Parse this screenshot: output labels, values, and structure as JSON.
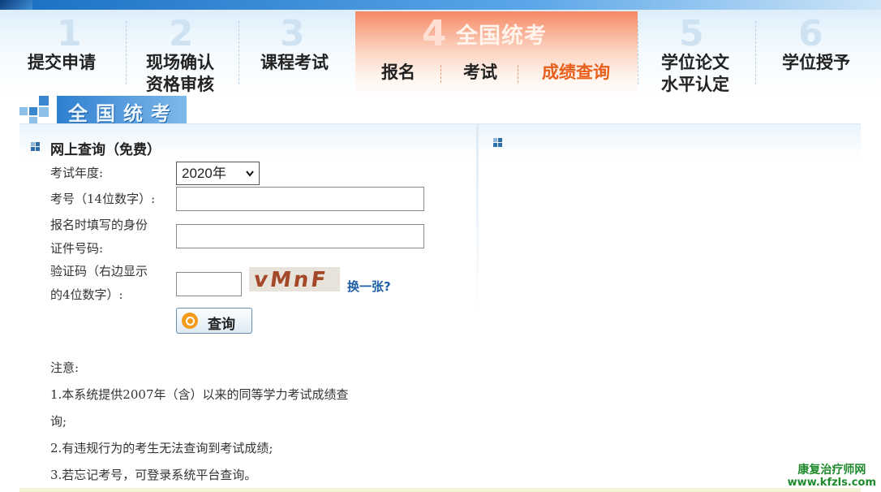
{
  "nav": {
    "steps": [
      {
        "num": "1",
        "label": "提交申请"
      },
      {
        "num": "2",
        "label_line1": "现场确认",
        "label_line2": "资格审核"
      },
      {
        "num": "3",
        "label": "课程考试"
      },
      {
        "num": "4",
        "title": "全国统考",
        "subs": [
          "报名",
          "考试",
          "成绩查询"
        ],
        "active_sub": "成绩查询"
      },
      {
        "num": "5",
        "label_line1": "学位论文",
        "label_line2": "水平认定"
      },
      {
        "num": "6",
        "label": "学位授予"
      }
    ]
  },
  "section": {
    "title": "全国统考"
  },
  "form": {
    "panel_title": "网上查询（免费）",
    "year_label": "考试年度:",
    "year_value": "2020年",
    "exam_no_label": "考号（14位数字）:",
    "id_label_line1": "报名时填写的身份",
    "id_label_line2": "证件号码:",
    "captcha_label_line1": "验证码（右边显示",
    "captcha_label_line2": "的4位数字）:",
    "captcha_text": "vMnF",
    "refresh_label": "换一张?",
    "submit_label": "查询"
  },
  "notes": {
    "title": "注意:",
    "line1a": "1.本系统提供2007年（含）以来的同等学力考试成绩查",
    "line1b": "询;",
    "line2": "2.有违规行为的考生无法查询到考试成绩;",
    "line3": "3.若忘记考号，可登录系统平台查询。"
  },
  "watermark": {
    "line1": "康复治疗师网",
    "line2": "www.kfzls.com"
  },
  "colors": {
    "accent": "#e8601c",
    "link": "#1f5fa8",
    "banner": "#2e7fd0"
  }
}
